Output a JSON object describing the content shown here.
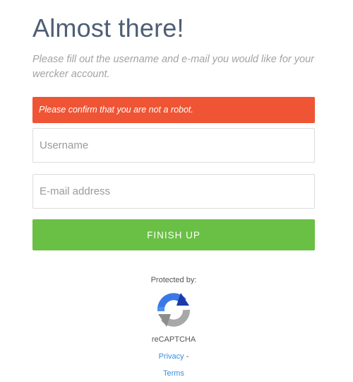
{
  "header": {
    "title": "Almost there!",
    "subtitle": "Please fill out the username and e-mail you would like for your wercker account."
  },
  "alert": {
    "message": "Please confirm that you are not a robot.",
    "color": "#ef5435"
  },
  "form": {
    "username_placeholder": "Username",
    "username_value": "",
    "email_placeholder": "E-mail address",
    "email_value": "",
    "submit_label": "FINISH UP",
    "submit_color": "#6abf45"
  },
  "recaptcha": {
    "protected_label": "Protected by:",
    "logo_icon": "recaptcha-logo-icon",
    "brand": "reCAPTCHA",
    "privacy_label": "Privacy",
    "separator": "-",
    "terms_label": "Terms"
  }
}
